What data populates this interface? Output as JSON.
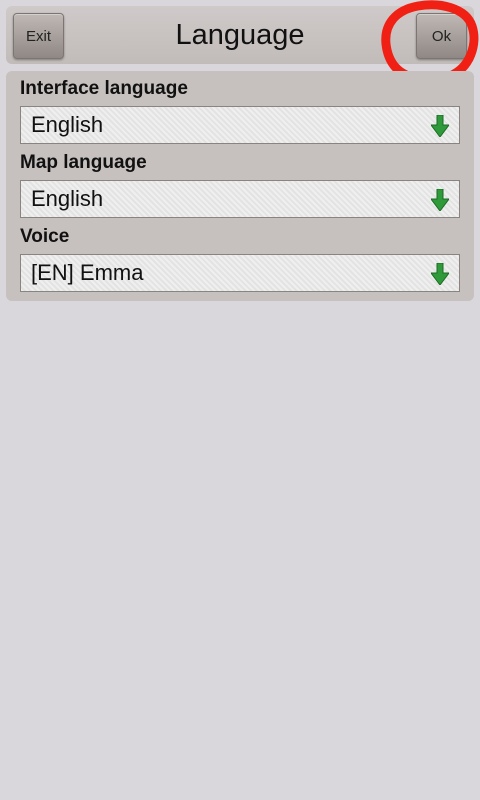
{
  "header": {
    "exit_label": "Exit",
    "title": "Language",
    "ok_label": "Ok"
  },
  "fields": [
    {
      "label": "Interface language",
      "value": "English"
    },
    {
      "label": "Map language",
      "value": "English"
    },
    {
      "label": "Voice",
      "value": "[EN] Emma"
    }
  ],
  "icons": {
    "dropdown_arrow": "arrow-down-icon"
  },
  "colors": {
    "arrow_green": "#2e9a3a",
    "annotation_red": "#f02015",
    "background": "#d9d6dc"
  }
}
